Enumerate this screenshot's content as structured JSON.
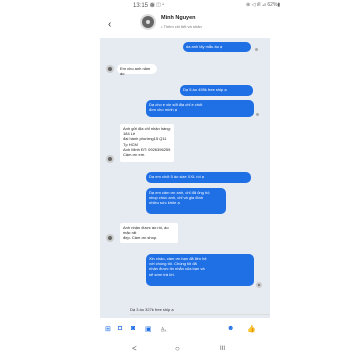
{
  "status": {
    "time": "13:15 ⊕",
    "icons": "▣ ◫ •",
    "right": "⊕ ◁ ıll ⊿ 62%▮"
  },
  "header": {
    "contact_name": "Minh Nguyen",
    "subtitle": "• Thêm chi tiết và nhãn"
  },
  "messages": [
    {
      "dir": "out",
      "text": "da anh lấy mẫu áo ạ"
    },
    {
      "dir": "in",
      "text": "Em cho anh năm áo"
    },
    {
      "dir": "out",
      "text": "Dạ 5 áo 495k free ship ạ"
    },
    {
      "dir": "out",
      "text": "Dạ cho e xin sđt địa chỉ e chốt\nđơn cho mình ạ"
    },
    {
      "dir": "in",
      "text": "Anh gửi địa chỉ nhận hàng: 184 Lê\nđại hành phường15 Q11 Tp HCM\nAnh Minh ĐT: 0926396259\nCảm ơn em."
    },
    {
      "dir": "out",
      "text": "Dạ em chốt 5 áo size XXL rồi ạ"
    },
    {
      "dir": "out",
      "text": "Dạ em cảm ơn anh, chỉ đã ủng hộ\nshop chúc anh, chỉ và gia đình\nnhiều sức khỏe ạ"
    },
    {
      "dir": "in",
      "text": "Anh nhận được áo rồi, áo mặc rất\nđẹp. Cảm ơn shop."
    },
    {
      "dir": "out",
      "text": "Xin chào, cảm ơn bạn đã liên hệ\nvới chúng tôi. Chúng tôi đã\nnhận được tin nhắn của bạn và\nsẽ sớm trả lời."
    }
  ],
  "composer": {
    "draft": "Dạ 3 áo 327k free ship ạ"
  },
  "toolbar": {
    "plus": "⊞",
    "camera": "◘",
    "image": "◙",
    "doc": "▣",
    "font": "A̲ₐ",
    "emoji": "☻",
    "like": "👍"
  },
  "nav": {
    "back": "<",
    "home": "○",
    "recent": "III"
  },
  "colors": {
    "accent": "#1f6fe5",
    "chat_bg": "#e6eaf1"
  }
}
